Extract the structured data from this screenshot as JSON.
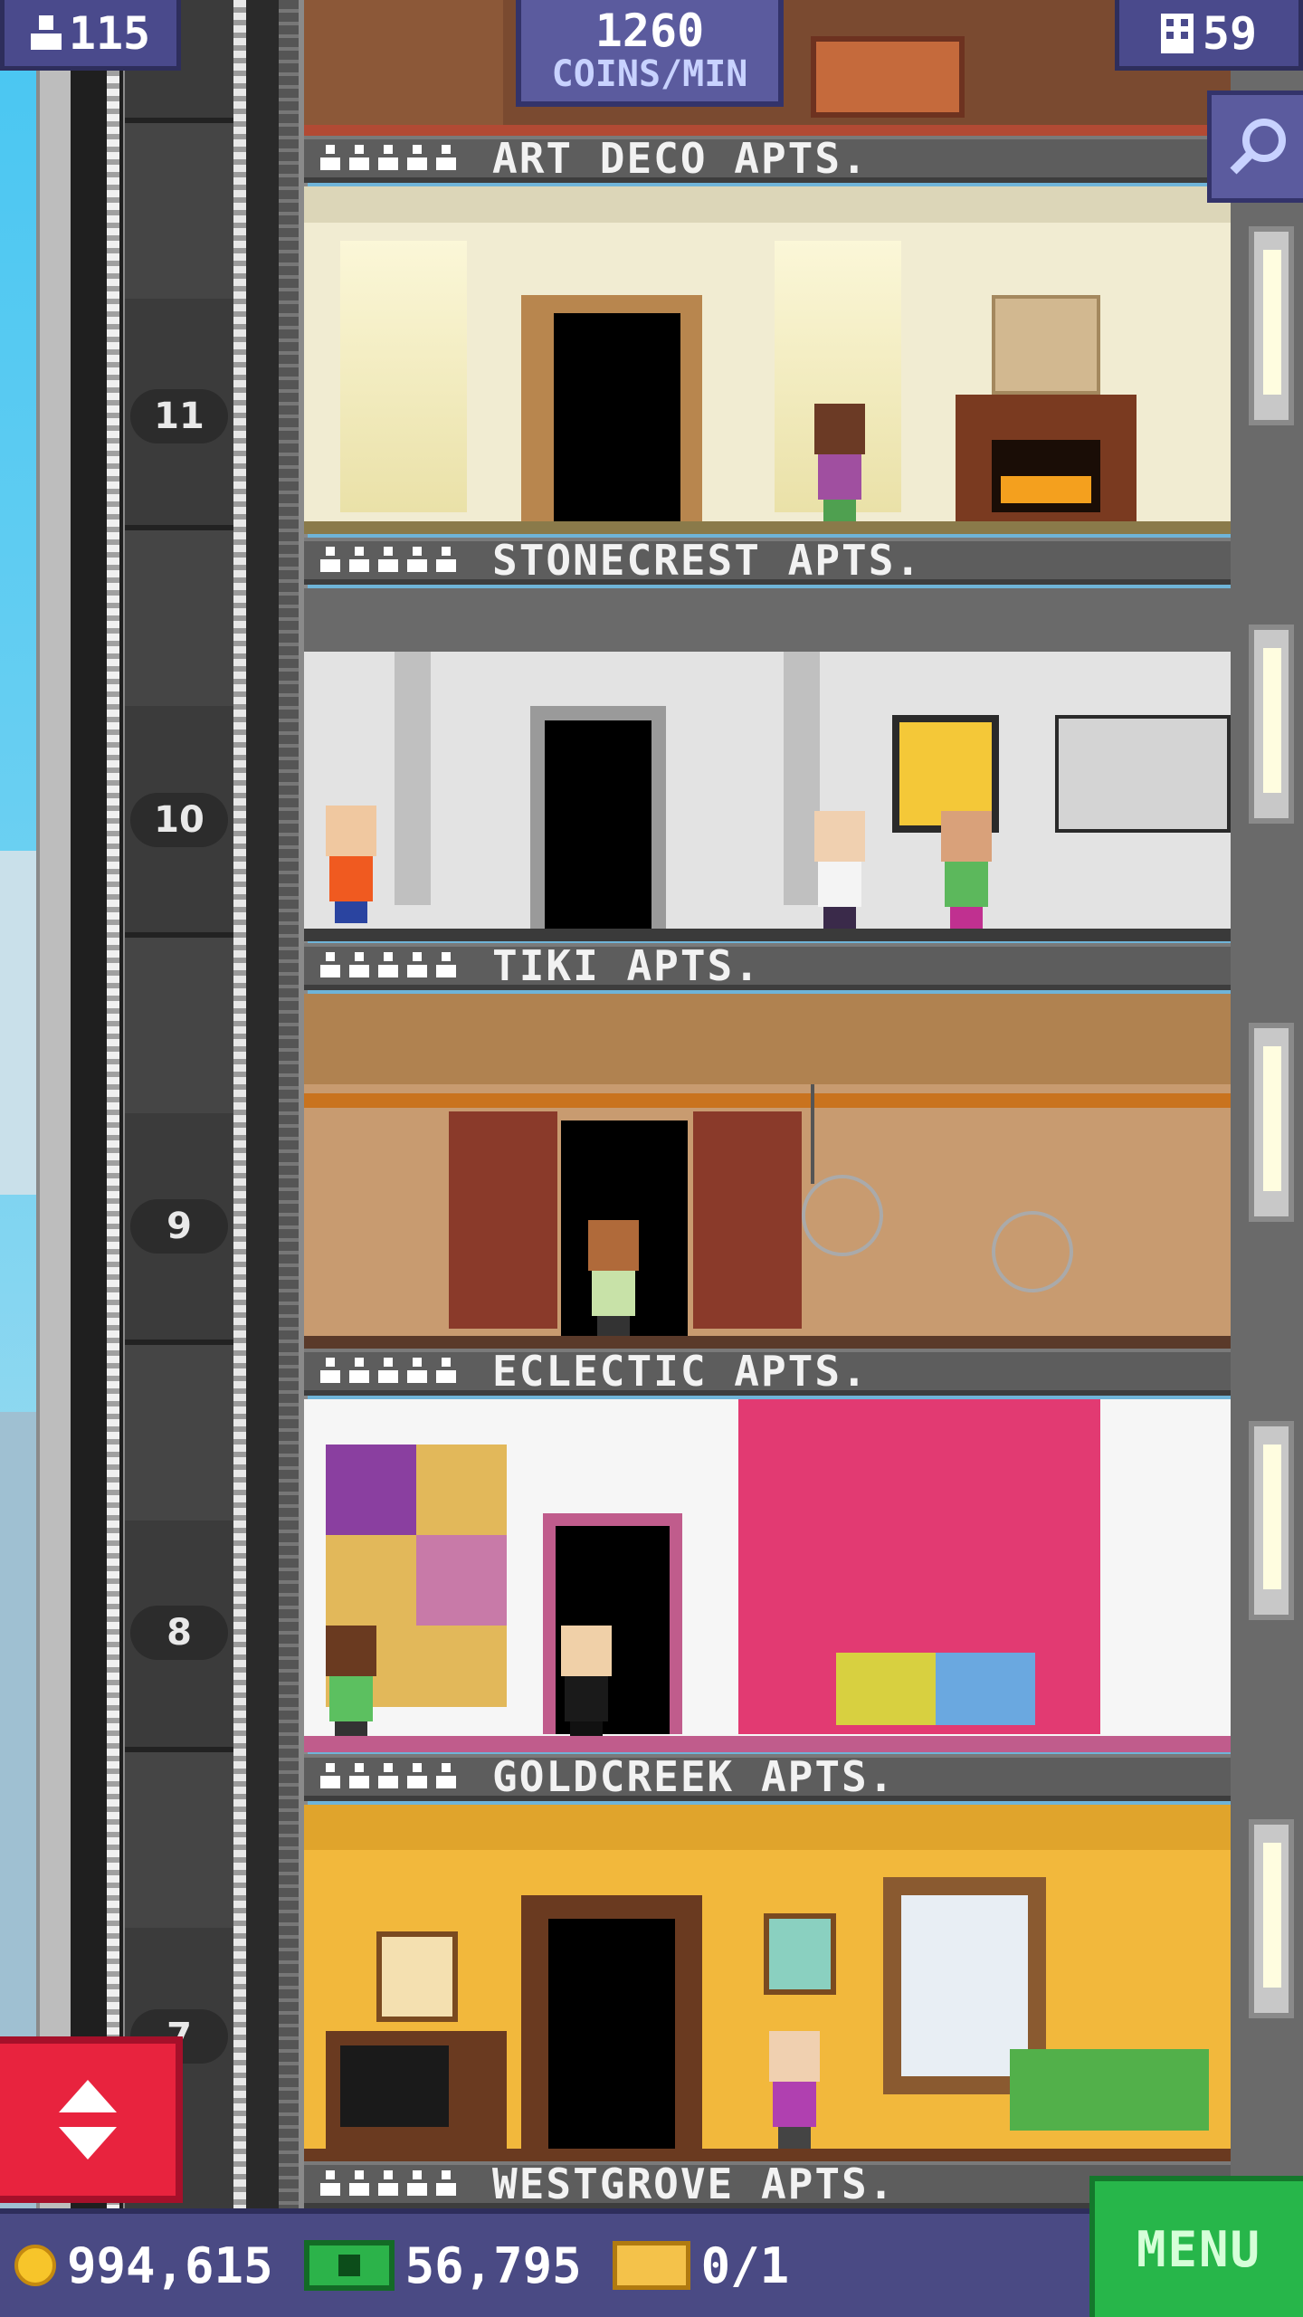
{
  "hud": {
    "population": "115",
    "coins_per_min": "1260",
    "coins_per_min_label": "COINS/MIN",
    "floors_count": "59"
  },
  "floors": [
    {
      "name": "ART DECO APTS.",
      "number": "",
      "occupants": 5
    },
    {
      "name": "STONECREST APTS.",
      "number": "11",
      "occupants": 5
    },
    {
      "name": "TIKI APTS.",
      "number": "10",
      "occupants": 5
    },
    {
      "name": "ECLECTIC APTS.",
      "number": "9",
      "occupants": 5
    },
    {
      "name": "GOLDCREEK APTS.",
      "number": "8",
      "occupants": 5
    },
    {
      "name": "WESTGROVE APTS.",
      "number": "7",
      "occupants": 5
    }
  ],
  "bottom_bar": {
    "coins": "994,615",
    "bux": "56,795",
    "tickets": "0/1",
    "menu_label": "MENU"
  },
  "icons": {
    "population": "person-icon",
    "floors": "building-icon",
    "search": "magnifier-icon",
    "elevator": "up-down-arrows-icon",
    "coin": "coin-icon",
    "bux": "bux-bill-icon",
    "ticket": "vip-ticket-icon"
  },
  "colors": {
    "hud_bg": "#4a4a8c",
    "menu_green": "#27b64a",
    "elevator_red": "#e8233e"
  }
}
